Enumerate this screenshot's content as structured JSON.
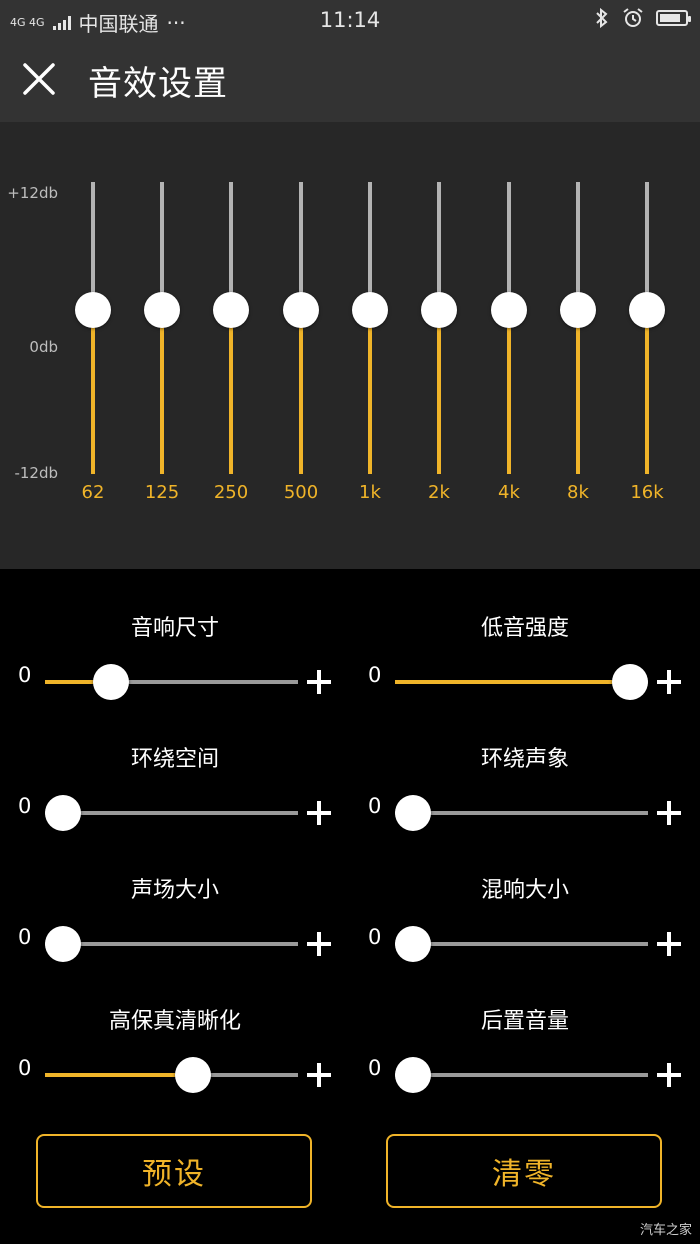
{
  "status_bar": {
    "network": "4G 4G",
    "carrier": "中国联通",
    "more": "···",
    "time": "11:14",
    "bluetooth_icon": "bluetooth-icon",
    "alarm_icon": "alarm-icon",
    "battery_level": 0.85
  },
  "header": {
    "close_icon": "close-icon",
    "title": "音效设置"
  },
  "equalizer": {
    "db_max": "+12db",
    "db_mid": "0db",
    "db_min": "-12db",
    "bands": [
      {
        "freq": "62",
        "gain_db": 0
      },
      {
        "freq": "125",
        "gain_db": 0
      },
      {
        "freq": "250",
        "gain_db": 0
      },
      {
        "freq": "500",
        "gain_db": 0
      },
      {
        "freq": "1k",
        "gain_db": 0
      },
      {
        "freq": "2k",
        "gain_db": 0
      },
      {
        "freq": "4k",
        "gain_db": 0
      },
      {
        "freq": "8k",
        "gain_db": 0
      },
      {
        "freq": "16k",
        "gain_db": 0
      }
    ]
  },
  "effects": [
    {
      "label": "音响尺寸",
      "min_label": "0",
      "value": 0.22
    },
    {
      "label": "低音强度",
      "min_label": "0",
      "value": 1.0
    },
    {
      "label": "环绕空间",
      "min_label": "0",
      "value": 0.0
    },
    {
      "label": "环绕声象",
      "min_label": "0",
      "value": 0.0
    },
    {
      "label": "声场大小",
      "min_label": "0",
      "value": 0.0
    },
    {
      "label": "混响大小",
      "min_label": "0",
      "value": 0.0
    },
    {
      "label": "高保真清晰化",
      "min_label": "0",
      "value": 0.6
    },
    {
      "label": "后置音量",
      "min_label": "0",
      "value": 0.0
    }
  ],
  "buttons": {
    "preset": "预设",
    "reset": "清零"
  },
  "colors": {
    "accent": "#f0b429",
    "header_bg": "#333333",
    "eq_bg": "#272727"
  },
  "watermark": "汽车之家"
}
